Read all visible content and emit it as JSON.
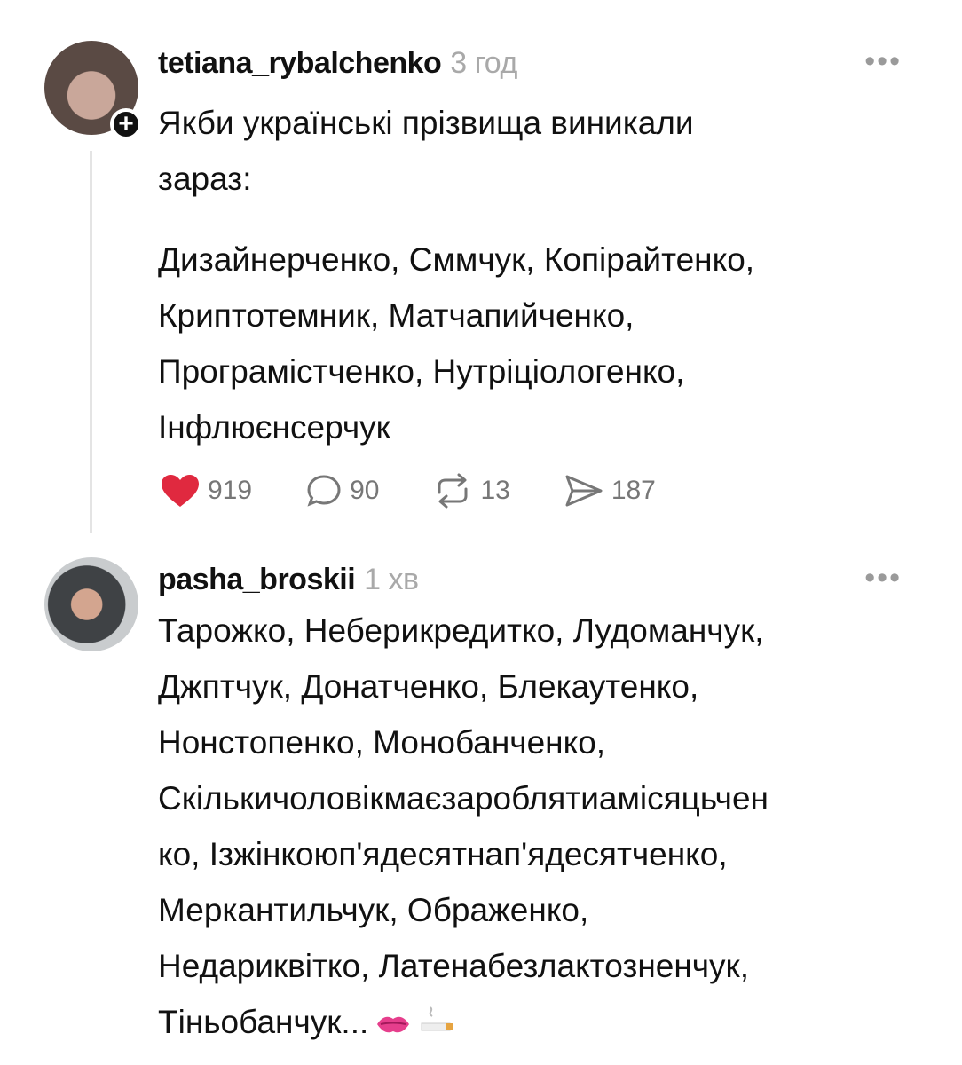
{
  "posts": [
    {
      "username": "tetiana_rybalchenko",
      "time": "3 год",
      "intro": "Якби українські прізвища виникали\nзараз:",
      "body": "Дизайнерченко, Сммчук, Копірайтенко,\nКриптотемник, Матчапийченко,\nПрограмістченко, Нутріціологенко,\nІнфлюєнсерчук",
      "likes": "919",
      "comments": "90",
      "reposts": "13",
      "shares": "187",
      "icons": [
        "plus-icon",
        "more-icon",
        "heart-icon",
        "comment-icon",
        "repost-icon",
        "share-icon"
      ],
      "heart_color": "#e0293f"
    },
    {
      "username": "pasha_broskii",
      "time": "1 хв",
      "body": "Тарожко, Неберикредитко, Лудоманчук,\nДжптчук, Донатченко, Блекаутенко,\nНонстопенко, Монобанченко,\nСкількичоловікмаєзароблятиамісяцьчен\nко, Ізжінкоюп'ядесятнап'ядесятченко,\nМеркантильчук, Ображенко,\nНедариквітко, Латенабезлактозненчук,\nТіньобанчук...",
      "emojis": [
        "lips-emoji",
        "cigarette-emoji"
      ]
    }
  ]
}
